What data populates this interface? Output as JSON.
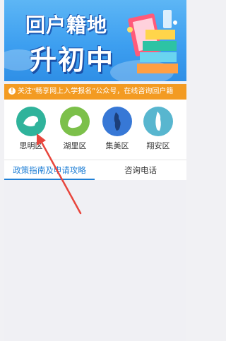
{
  "banner": {
    "title_line1": "回户籍地",
    "title_line2": "升初中"
  },
  "notice": {
    "text": "关注“畅享网上入学报名”公众号，在线咨询回户籍"
  },
  "districts": [
    {
      "label": "思明区",
      "color": "#2fb39b"
    },
    {
      "label": "湖里区",
      "color": "#7cc04a"
    },
    {
      "label": "集美区",
      "color": "#3778d6"
    },
    {
      "label": "翔安区",
      "color": "#58b6cf"
    }
  ],
  "tabs": [
    {
      "label": "政策指南及申请攻略",
      "active": true
    },
    {
      "label": "咨询电话",
      "active": false
    }
  ],
  "colors": {
    "accent": "#1f7fd6",
    "notice_bg": "#f39b22",
    "annotation_arrow": "#e8453c"
  }
}
